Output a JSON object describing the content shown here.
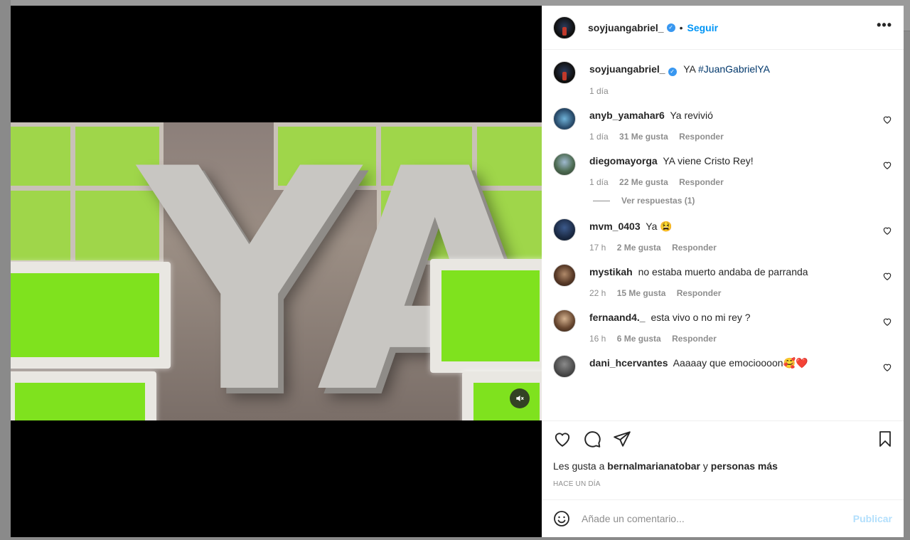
{
  "post": {
    "author": "soyjuangabriel_",
    "verified_mark": "✓",
    "dot": "•",
    "follow_label": "Seguir",
    "more_label": "•••",
    "caption_text": "YA",
    "caption_hashtag": "#JuanGabrielYA",
    "caption_age": "1 día",
    "video_text": "YA"
  },
  "comments": [
    {
      "user": "anyb_yamahar6",
      "text": "Ya revivió",
      "age": "1 día",
      "likes": "31 Me gusta",
      "reply": "Responder"
    },
    {
      "user": "diegomayorga",
      "text": "YA viene Cristo Rey!",
      "age": "1 día",
      "likes": "22 Me gusta",
      "reply": "Responder",
      "view_replies": "Ver respuestas (1)"
    },
    {
      "user": "mvm_0403",
      "text": "Ya 😫",
      "age": "17 h",
      "likes": "2 Me gusta",
      "reply": "Responder"
    },
    {
      "user": "mystikah",
      "text": "no estaba muerto andaba de parranda",
      "age": "22 h",
      "likes": "15 Me gusta",
      "reply": "Responder"
    },
    {
      "user": "fernaand4._",
      "text": "esta vivo o no mi rey ?",
      "age": "16 h",
      "likes": "6 Me gusta",
      "reply": "Responder"
    },
    {
      "user": "dani_hcervantes",
      "text": "Aaaaay que emocioooon🥰❤️",
      "age": "",
      "likes": "",
      "reply": ""
    }
  ],
  "likes_line": {
    "prefix": "Les gusta a",
    "user": "bernalmarianatobar",
    "join": "y",
    "others": "personas más"
  },
  "timestamp": "HACE UN DÍA",
  "composer": {
    "placeholder": "Añade un comentario...",
    "publish_label": "Publicar"
  },
  "colors": {
    "accent": "#0095f6",
    "verified": "#3897f0",
    "hashtag": "#00376b",
    "publish_disabled": "#b2dffc"
  }
}
